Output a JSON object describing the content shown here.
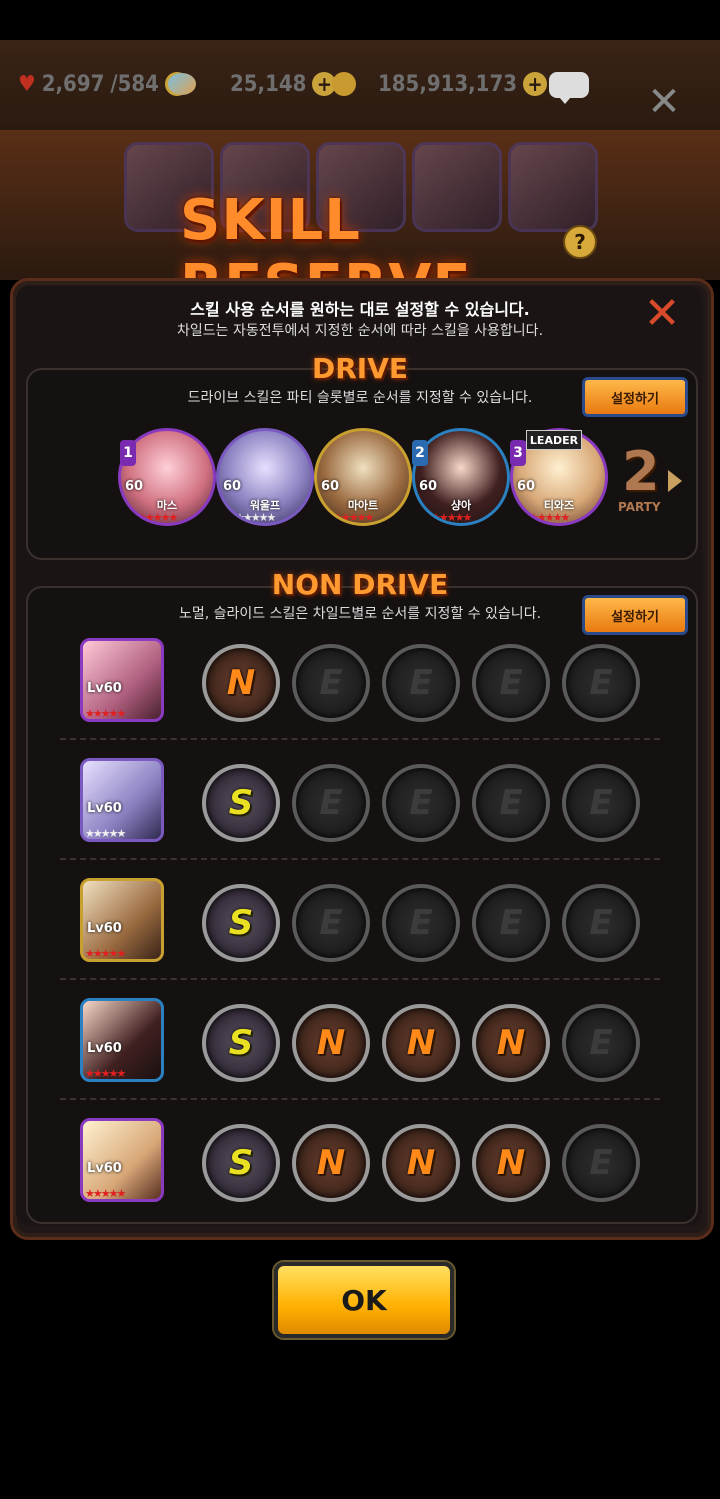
{
  "resources": {
    "stamina": "2,697",
    "stamina_max": "/584",
    "gems": "25,148",
    "gold": "185,913,173",
    "plus": "+"
  },
  "header": {
    "title": "SKILL RESERVE",
    "help": "?",
    "subtitle1": "스킬 사용 순서를 원하는 대로 설정할 수 있습니다.",
    "subtitle2": "차일드는 자동전투에서 지정한 순서에 따라 스킬을 사용합니다.",
    "close": "✕"
  },
  "drive": {
    "title": "DRIVE",
    "hint": "드라이브 스킬은 파티 슬롯별로 순서를 지정할 수 있습니다.",
    "set_label": "설정하기",
    "leader_tag": "LEADER",
    "party_number": "2",
    "party_label": "PARTY",
    "members": [
      {
        "order": "1",
        "level": "60",
        "name": "마스"
      },
      {
        "order": "",
        "level": "60",
        "name": "워울프"
      },
      {
        "order": "",
        "level": "60",
        "name": "마아트"
      },
      {
        "order": "2",
        "level": "60",
        "name": "샹아"
      },
      {
        "order": "3",
        "level": "60",
        "name": "티와즈"
      }
    ],
    "star_text": "★★★★★"
  },
  "non_drive": {
    "title": "NON DRIVE",
    "hint": "노멀, 슬라이드 스킬은 차일드별로 순서를 지정할 수 있습니다.",
    "set_label": "설정하기",
    "rows": [
      {
        "level": "Lv60",
        "slots": [
          "N",
          "E",
          "E",
          "E",
          "E"
        ]
      },
      {
        "level": "Lv60",
        "slots": [
          "S",
          "E",
          "E",
          "E",
          "E"
        ]
      },
      {
        "level": "Lv60",
        "slots": [
          "S",
          "E",
          "E",
          "E",
          "E"
        ]
      },
      {
        "level": "Lv60",
        "slots": [
          "S",
          "N",
          "N",
          "N",
          "E"
        ]
      },
      {
        "level": "Lv60",
        "slots": [
          "S",
          "N",
          "N",
          "N",
          "E"
        ]
      }
    ],
    "star_text": "★★★★★"
  },
  "ok_label": "OK"
}
